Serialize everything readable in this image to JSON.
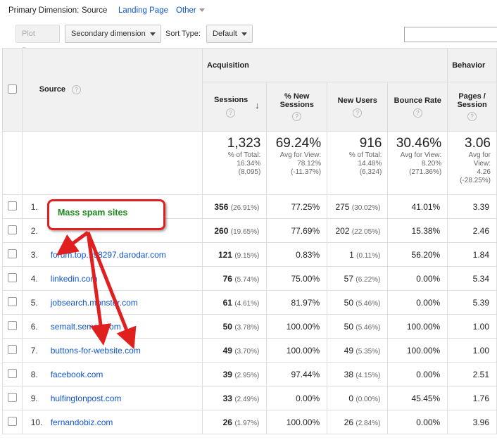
{
  "primary_dimension": {
    "label": "Primary Dimension:",
    "active": "Source",
    "options": [
      "Landing Page",
      "Other"
    ]
  },
  "toolbar": {
    "plot_rows": "Plot Rows",
    "secondary_dimension": "Secondary dimension",
    "sort_type_label": "Sort Type:",
    "sort_type_value": "Default",
    "search_value": ""
  },
  "table": {
    "groups": {
      "acquisition": "Acquisition",
      "behavior": "Behavior"
    },
    "columns": {
      "source": "Source",
      "sessions": "Sessions",
      "new_sessions": "% New Sessions",
      "new_users": "New Users",
      "bounce_rate": "Bounce Rate",
      "pages_session": "Pages / Session"
    },
    "help": "?",
    "totals": {
      "sessions": {
        "value": "1,323",
        "l1": "% of Total:",
        "l2": "16.34%",
        "l3": "(8,095)"
      },
      "new_sessions": {
        "value": "69.24%",
        "l1": "Avg for View:",
        "l2": "78.12%",
        "l3": "(-11.37%)"
      },
      "new_users": {
        "value": "916",
        "l1": "% of Total:",
        "l2": "14.48%",
        "l3": "(6,324)"
      },
      "bounce_rate": {
        "value": "30.46%",
        "l1": "Avg for View:",
        "l2": "8.20%",
        "l3": "(271.36%)"
      },
      "pages_session": {
        "value": "3.06",
        "l1": "Avg for",
        "l2": "View:",
        "l3": "4.26",
        "l4": "(-28.25%)"
      }
    },
    "rows": [
      {
        "idx": "1.",
        "source": "",
        "sessions": "356",
        "sessions_pct": "(26.91%)",
        "new_sessions": "77.25%",
        "new_users": "275",
        "new_users_pct": "(30.02%)",
        "bounce": "41.01%",
        "pages": "3.39"
      },
      {
        "idx": "2.",
        "source": "",
        "sessions": "260",
        "sessions_pct": "(19.65%)",
        "new_sessions": "77.69%",
        "new_users": "202",
        "new_users_pct": "(22.05%)",
        "bounce": "15.38%",
        "pages": "2.46"
      },
      {
        "idx": "3.",
        "source": "forum.top...98297.darodar.com",
        "sessions": "121",
        "sessions_pct": "(9.15%)",
        "new_sessions": "0.83%",
        "new_users": "1",
        "new_users_pct": "(0.11%)",
        "bounce": "56.20%",
        "pages": "1.84"
      },
      {
        "idx": "4.",
        "source": "linkedin.com",
        "sessions": "76",
        "sessions_pct": "(5.74%)",
        "new_sessions": "75.00%",
        "new_users": "57",
        "new_users_pct": "(6.22%)",
        "bounce": "0.00%",
        "pages": "5.34"
      },
      {
        "idx": "5.",
        "source": "jobsearch.monster.com",
        "sessions": "61",
        "sessions_pct": "(4.61%)",
        "new_sessions": "81.97%",
        "new_users": "50",
        "new_users_pct": "(5.46%)",
        "bounce": "0.00%",
        "pages": "5.39"
      },
      {
        "idx": "6.",
        "source": "semalt.semalt.com",
        "sessions": "50",
        "sessions_pct": "(3.78%)",
        "new_sessions": "100.00%",
        "new_users": "50",
        "new_users_pct": "(5.46%)",
        "bounce": "100.00%",
        "pages": "1.00"
      },
      {
        "idx": "7.",
        "source": "buttons-for-website.com",
        "sessions": "49",
        "sessions_pct": "(3.70%)",
        "new_sessions": "100.00%",
        "new_users": "49",
        "new_users_pct": "(5.35%)",
        "bounce": "100.00%",
        "pages": "1.00"
      },
      {
        "idx": "8.",
        "source": "facebook.com",
        "sessions": "39",
        "sessions_pct": "(2.95%)",
        "new_sessions": "97.44%",
        "new_users": "38",
        "new_users_pct": "(4.15%)",
        "bounce": "0.00%",
        "pages": "2.51"
      },
      {
        "idx": "9.",
        "source": "hulfingtonpost.com",
        "sessions": "33",
        "sessions_pct": "(2.49%)",
        "new_sessions": "0.00%",
        "new_users": "0",
        "new_users_pct": "(0.00%)",
        "bounce": "45.45%",
        "pages": "1.76"
      },
      {
        "idx": "10.",
        "source": "fernandobiz.com",
        "sessions": "26",
        "sessions_pct": "(1.97%)",
        "new_sessions": "100.00%",
        "new_users": "26",
        "new_users_pct": "(2.84%)",
        "bounce": "0.00%",
        "pages": "3.96"
      }
    ]
  },
  "annotation": {
    "label": "Mass spam sites",
    "color": "#e01f1f",
    "text_color": "#1a8a1a"
  }
}
